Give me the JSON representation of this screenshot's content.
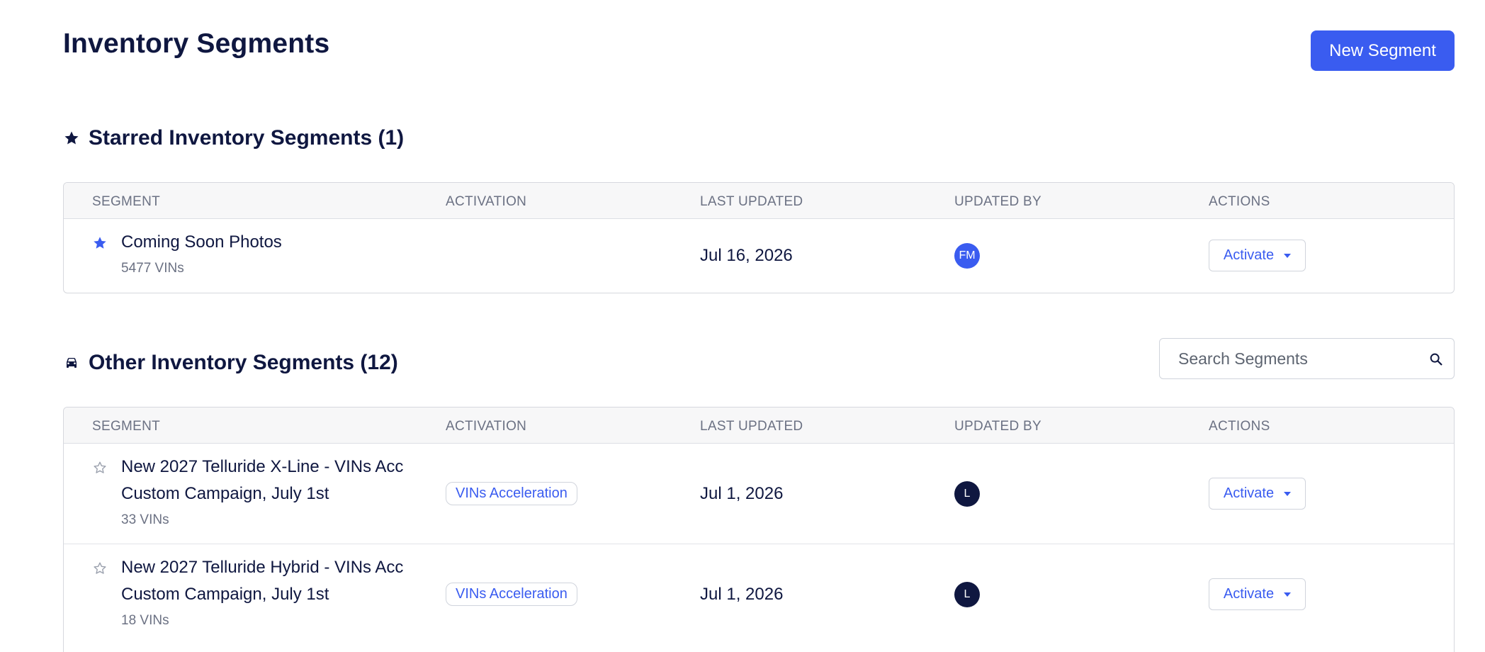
{
  "header": {
    "title": "Inventory Segments",
    "new_button": "New Segment"
  },
  "starred": {
    "title": "Starred Inventory Segments (1)",
    "columns": [
      "SEGMENT",
      "ACTIVATION",
      "LAST UPDATED",
      "UPDATED BY",
      "ACTIONS"
    ],
    "rows": [
      {
        "name": "Coming Soon Photos",
        "count": "5477 VINs",
        "activation": "",
        "updated": "Jul 16, 2026",
        "by": "FM",
        "action": "Activate",
        "starred": true
      }
    ]
  },
  "other": {
    "title": "Other Inventory Segments (12)",
    "search_placeholder": "Search Segments",
    "columns": [
      "SEGMENT",
      "ACTIVATION",
      "LAST UPDATED",
      "UPDATED BY",
      "ACTIONS"
    ],
    "rows": [
      {
        "name_line1": "New 2027 Telluride X-Line - VINs Acc",
        "name_line2": "Custom Campaign, July 1st",
        "count": "33 VINs",
        "activation": "VINs Acceleration",
        "updated": "Jul 1, 2026",
        "by": "L",
        "action": "Activate",
        "starred": false
      },
      {
        "name_line1": "New 2027 Telluride Hybrid - VINs Acc",
        "name_line2": "Custom Campaign, July 1st",
        "count": "18 VINs",
        "activation": "VINs Acceleration",
        "updated": "Jul 1, 2026",
        "by": "L",
        "action": "Activate",
        "starred": false
      }
    ]
  },
  "colors": {
    "accent": "#3a5cf0",
    "text": "#0f1740",
    "muted": "#6b7183",
    "avatar_dark": "#0f1740"
  },
  "icons": {
    "starred_section": "star-filled-icon",
    "other_section": "car-icon",
    "search": "search-icon",
    "star_empty": "star-outline-icon"
  }
}
